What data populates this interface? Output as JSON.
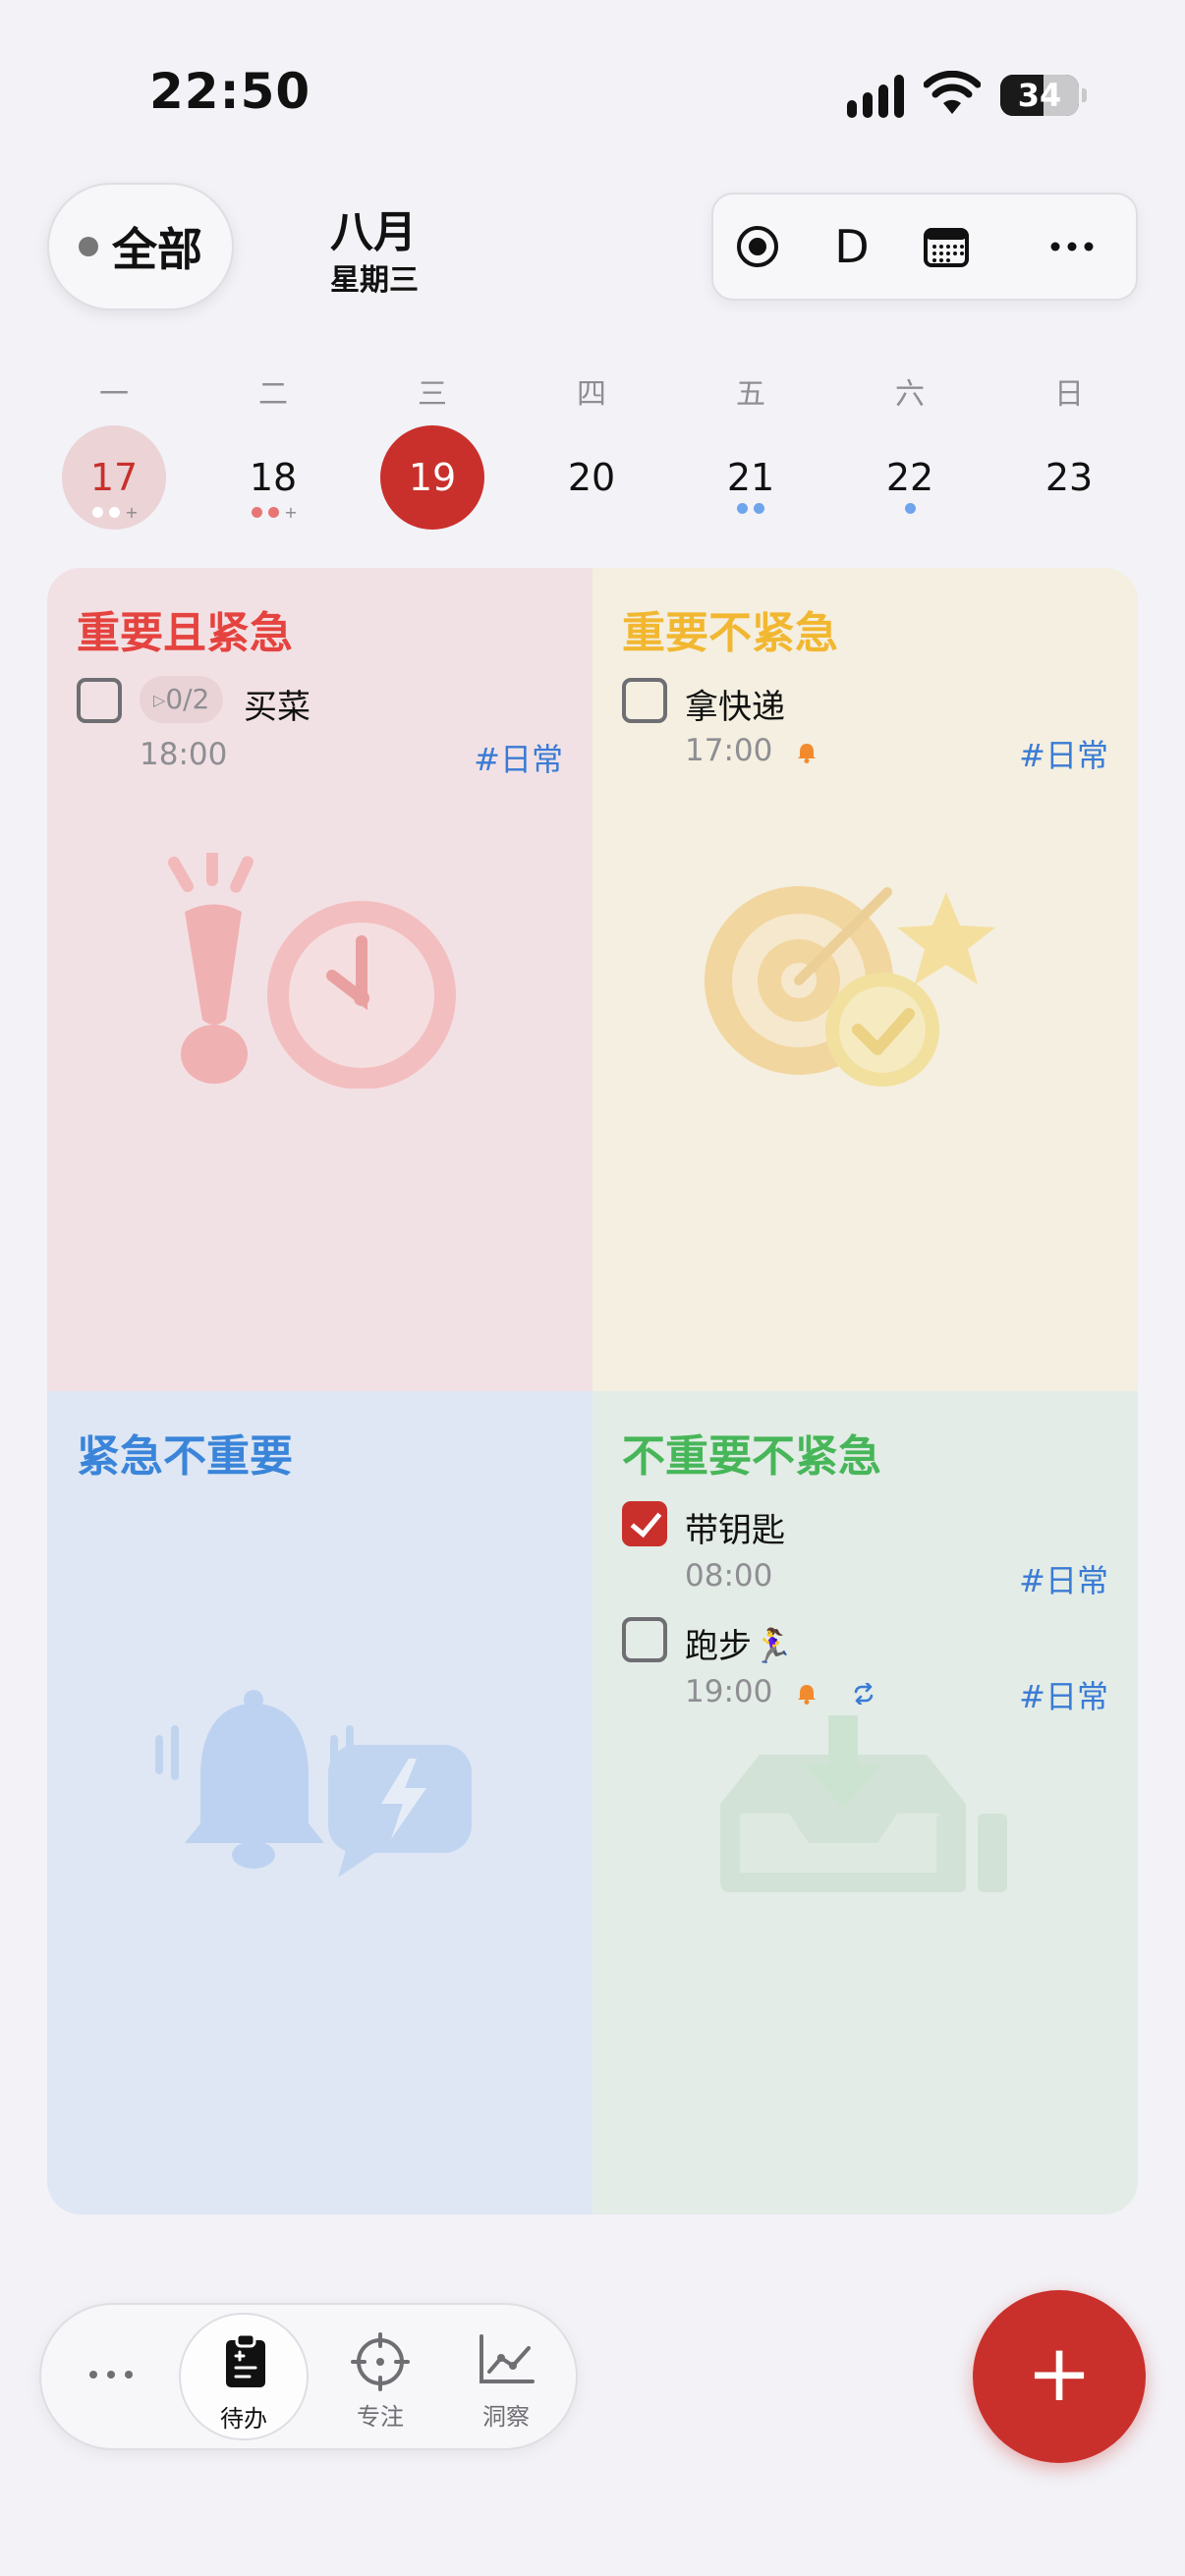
{
  "status_bar": {
    "time": "22:50",
    "battery": "34"
  },
  "header": {
    "filter_label": "全部",
    "month": "八月",
    "weekday": "星期三",
    "toolbar": {
      "view_mode": "D"
    }
  },
  "week": {
    "labels": [
      "一",
      "二",
      "三",
      "四",
      "五",
      "六",
      "日"
    ],
    "days": [
      "17",
      "18",
      "19",
      "20",
      "21",
      "22",
      "23"
    ],
    "today_index": 2,
    "muted_index": 0
  },
  "colors": {
    "accent_red": "#c9302c",
    "q1_title": "#e5433f",
    "q2_title": "#f2b731",
    "q3_title": "#3a85d9",
    "q4_title": "#47b659",
    "tag_blue": "#3a7bd5",
    "bell_orange": "#f28a2e"
  },
  "quadrants": [
    {
      "title": "重要且紧急",
      "tasks": [
        {
          "name": "买菜",
          "time": "18:00",
          "tag": "#日常",
          "subtasks": "0/2",
          "done": false
        }
      ],
      "illustration": "exclamation-clock"
    },
    {
      "title": "重要不紧急",
      "tasks": [
        {
          "name": "拿快递",
          "time": "17:00",
          "tag": "#日常",
          "reminder": true,
          "done": false
        }
      ],
      "illustration": "target-star-check"
    },
    {
      "title": "紧急不重要",
      "tasks": [],
      "illustration": "bell-chat-lightning"
    },
    {
      "title": "不重要不紧急",
      "tasks": [
        {
          "name": "带钥匙",
          "time": "08:00",
          "tag": "#日常",
          "done": true
        },
        {
          "name": "跑步🏃‍♀️",
          "time": "19:00",
          "tag": "#日常",
          "reminder": true,
          "repeat": true,
          "done": false
        }
      ],
      "illustration": "inbox-download"
    }
  ],
  "tabbar": {
    "tabs": [
      {
        "label": "待办",
        "icon": "clipboard-icon"
      },
      {
        "label": "专注",
        "icon": "crosshair-icon"
      },
      {
        "label": "洞察",
        "icon": "chart-icon"
      }
    ]
  },
  "fab_label": "+"
}
